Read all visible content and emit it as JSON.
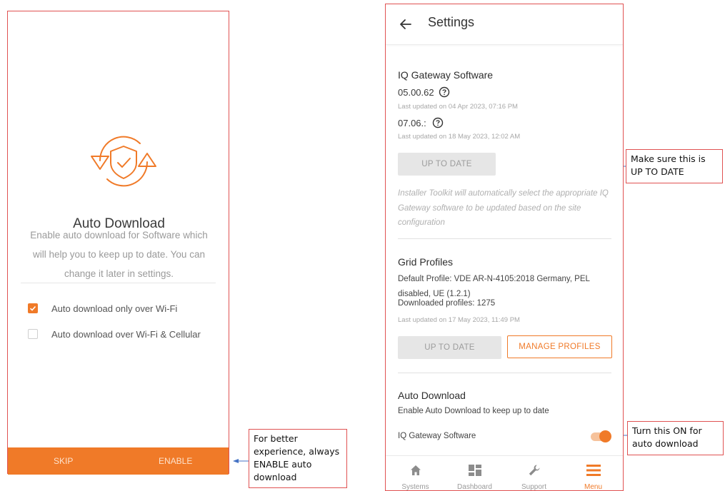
{
  "auto_download_screen": {
    "title": "Auto Download",
    "description": "Enable auto download for Software which will help you to keep up to date. You can change it later in settings.",
    "options": [
      {
        "label": "Auto download only over Wi-Fi",
        "checked": true
      },
      {
        "label": "Auto download over Wi-Fi & Cellular",
        "checked": false
      }
    ],
    "skip_label": "SKIP",
    "enable_label": "ENABLE"
  },
  "settings_screen": {
    "title": "Settings",
    "gateway_software": {
      "title": "IQ Gateway Software",
      "version1": "05.00.62",
      "updated1": "Last updated on 04 Apr 2023, 07:16 PM",
      "version2": "07.06.:",
      "updated2": "Last updated on 18 May 2023, 12:02 AM",
      "button_label": "UP TO DATE",
      "note": "Installer Toolkit will automatically select the appropriate IQ Gateway software to be updated based on the site configuration"
    },
    "grid_profiles": {
      "title": "Grid Profiles",
      "default_profile": "Default Profile: VDE AR-N-4105:2018 Germany, PEL disabled, UE (1.2.1)",
      "downloaded": "Downloaded profiles: 1275",
      "updated": "Last updated on 17 May 2023, 11:49 PM",
      "uptodate_label": "UP TO DATE",
      "manage_label": "MANAGE PROFILES"
    },
    "auto_download": {
      "title": "Auto Download",
      "description": "Enable Auto Download to keep up to date",
      "toggle_label": "IQ Gateway Software",
      "toggle_on": true
    },
    "bottom_nav": [
      {
        "label": "Systems",
        "icon": "home-icon",
        "active": false
      },
      {
        "label": "Dashboard",
        "icon": "dashboard-icon",
        "active": false
      },
      {
        "label": "Support",
        "icon": "wrench-icon",
        "active": false
      },
      {
        "label": "Menu",
        "icon": "menu-icon",
        "active": true
      }
    ]
  },
  "callouts": {
    "left": "For better experience, always ENABLE auto download",
    "top": "Make sure this is UP TO DATE",
    "bottom": "Turn this ON for auto download"
  },
  "colors": {
    "accent": "#f07a28",
    "callout_border": "#e05252",
    "arrow": "#4472c4"
  }
}
